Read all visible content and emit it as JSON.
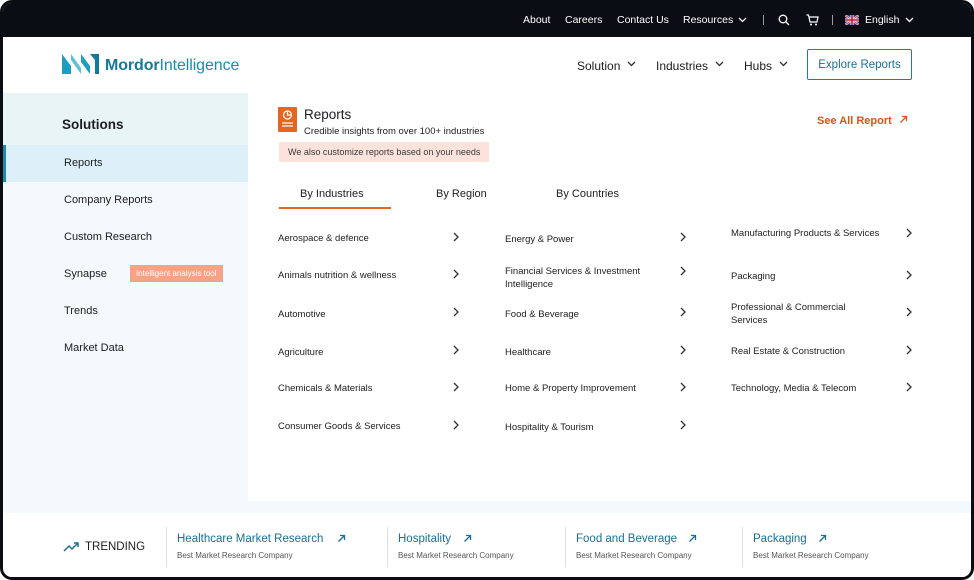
{
  "topbar": {
    "links": [
      "About",
      "Careers",
      "Contact Us",
      "Resources"
    ],
    "language": "English",
    "icons": [
      "chevron-down-icon",
      "search-icon",
      "cart-icon",
      "uk-flag-icon"
    ]
  },
  "header": {
    "logo": {
      "brand": "Mordor",
      "suffix": "Intelligence"
    },
    "nav": [
      "Solution",
      "Industries",
      "Hubs"
    ],
    "cta": "Explore Reports"
  },
  "sidebar": {
    "title": "Solutions",
    "items": [
      {
        "label": "Reports",
        "active": true
      },
      {
        "label": "Company Reports"
      },
      {
        "label": "Custom Research"
      },
      {
        "label": "Synapse",
        "tag": "Intelligent analysis tool"
      },
      {
        "label": "Trends"
      },
      {
        "label": "Market Data"
      }
    ]
  },
  "reports": {
    "title": "Reports",
    "subtitle": "Credible insights from over 100+ industries",
    "note": "We also customize reports based on your needs",
    "see_all": "See All Report",
    "tabs": [
      "By Industries",
      "By Region",
      "By Countries"
    ],
    "active_tab": "By Industries",
    "columns": [
      [
        "Aerospace & defence",
        "Animals nutrition & wellness",
        "Automotive",
        "Agriculture",
        "Chemicals & Materials",
        "Consumer Goods & Services"
      ],
      [
        "Energy & Power",
        "Financial Services & Investment Intelligence",
        "Food & Beverage",
        "Healthcare",
        "Home & Property Improvement",
        "Hospitality & Tourism"
      ],
      [
        "Manufacturing Products & Services",
        "Packaging",
        "Professional & Commercial Services",
        "Real Estate & Construction",
        "Technology, Media & Telecom"
      ]
    ]
  },
  "trending": {
    "label": "TRENDING",
    "items": [
      {
        "title": "Healthcare Market Research",
        "sub": "Best Market Research Company"
      },
      {
        "title": "Hospitality",
        "sub": "Best Market Research Company"
      },
      {
        "title": "Food and Beverage",
        "sub": "Best Market Research Company"
      },
      {
        "title": "Packaging",
        "sub": "Best Market Research Company"
      }
    ]
  },
  "colors": {
    "accent": "#1a8cb0",
    "orange": "#e8651e",
    "tag": "#f5a285",
    "topbar": "#0b0d14"
  }
}
